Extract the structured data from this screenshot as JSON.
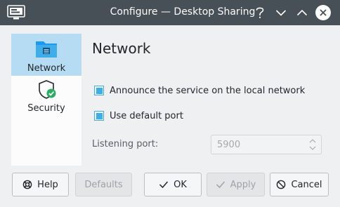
{
  "window": {
    "title": "Configure — Desktop Sharing",
    "titlebar_buttons": [
      "help",
      "minimize",
      "maximize",
      "close"
    ]
  },
  "sidebar": {
    "items": [
      {
        "label": "Network",
        "icon": "folder-network-icon",
        "selected": true
      },
      {
        "label": "Security",
        "icon": "shield-check-icon",
        "selected": false
      }
    ]
  },
  "page": {
    "title": "Network",
    "announce_label": "Announce the service on the local network",
    "announce_checked": true,
    "default_port_label": "Use default port",
    "default_port_checked": true,
    "listening_port_label": "Listening port:",
    "listening_port_value": "5900",
    "listening_port_enabled": false
  },
  "buttons": {
    "help": "Help",
    "defaults": "Defaults",
    "ok": "OK",
    "apply": "Apply",
    "cancel": "Cancel"
  },
  "colors": {
    "titlebar": "#475057",
    "accent": "#3daee9",
    "selection": "#b6dcf4",
    "window_bg": "#eff0f1",
    "security_badge": "#27ae60"
  }
}
